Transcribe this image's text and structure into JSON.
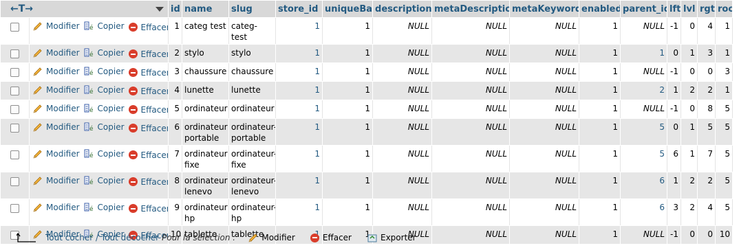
{
  "actions": {
    "edit": "Modifier",
    "copy": "Copier",
    "delete": "Effacer"
  },
  "header": {
    "nav_arrows": "←T→",
    "columns": [
      "id",
      "name",
      "slug",
      "store_id",
      "uniqueBase",
      "description",
      "metaDescription",
      "metaKeywords",
      "enabled",
      "parent_id",
      "lft",
      "lvl",
      "rgt",
      "root"
    ]
  },
  "rows": [
    {
      "id": "1",
      "name": "categ test",
      "slug": "categ-test",
      "store_id": "1",
      "uniqueBase": "1",
      "description": "NULL",
      "metaDescription": "NULL",
      "metaKeywords": "NULL",
      "enabled": "1",
      "parent_id": "NULL",
      "lft": "-1",
      "lvl": "0",
      "rgt": "4",
      "root": "1"
    },
    {
      "id": "2",
      "name": "stylo",
      "slug": "stylo",
      "store_id": "1",
      "uniqueBase": "1",
      "description": "NULL",
      "metaDescription": "NULL",
      "metaKeywords": "NULL",
      "enabled": "1",
      "parent_id": "1",
      "lft": "0",
      "lvl": "1",
      "rgt": "3",
      "root": "1"
    },
    {
      "id": "3",
      "name": "chaussure",
      "slug": "chaussure",
      "store_id": "1",
      "uniqueBase": "1",
      "description": "NULL",
      "metaDescription": "NULL",
      "metaKeywords": "NULL",
      "enabled": "1",
      "parent_id": "NULL",
      "lft": "-1",
      "lvl": "0",
      "rgt": "0",
      "root": "3"
    },
    {
      "id": "4",
      "name": "lunette",
      "slug": "lunette",
      "store_id": "1",
      "uniqueBase": "1",
      "description": "NULL",
      "metaDescription": "NULL",
      "metaKeywords": "NULL",
      "enabled": "1",
      "parent_id": "2",
      "lft": "1",
      "lvl": "2",
      "rgt": "2",
      "root": "1"
    },
    {
      "id": "5",
      "name": "ordinateur",
      "slug": "ordinateur",
      "store_id": "1",
      "uniqueBase": "1",
      "description": "NULL",
      "metaDescription": "NULL",
      "metaKeywords": "NULL",
      "enabled": "1",
      "parent_id": "NULL",
      "lft": "-1",
      "lvl": "0",
      "rgt": "8",
      "root": "5"
    },
    {
      "id": "6",
      "name": "ordinateur portable",
      "slug": "ordinateur-portable",
      "store_id": "1",
      "uniqueBase": "1",
      "description": "NULL",
      "metaDescription": "NULL",
      "metaKeywords": "NULL",
      "enabled": "1",
      "parent_id": "5",
      "lft": "0",
      "lvl": "1",
      "rgt": "5",
      "root": "5"
    },
    {
      "id": "7",
      "name": "ordinateur fixe",
      "slug": "ordinateur-fixe",
      "store_id": "1",
      "uniqueBase": "1",
      "description": "NULL",
      "metaDescription": "NULL",
      "metaKeywords": "NULL",
      "enabled": "1",
      "parent_id": "5",
      "lft": "6",
      "lvl": "1",
      "rgt": "7",
      "root": "5"
    },
    {
      "id": "8",
      "name": "ordinateur lenevo",
      "slug": "ordinateur-lenevo",
      "store_id": "1",
      "uniqueBase": "1",
      "description": "NULL",
      "metaDescription": "NULL",
      "metaKeywords": "NULL",
      "enabled": "1",
      "parent_id": "6",
      "lft": "1",
      "lvl": "2",
      "rgt": "2",
      "root": "5"
    },
    {
      "id": "9",
      "name": "ordinateur hp",
      "slug": "ordinateur-hp",
      "store_id": "1",
      "uniqueBase": "1",
      "description": "NULL",
      "metaDescription": "NULL",
      "metaKeywords": "NULL",
      "enabled": "1",
      "parent_id": "6",
      "lft": "3",
      "lvl": "2",
      "rgt": "4",
      "root": "5"
    },
    {
      "id": "10",
      "name": "tablette",
      "slug": "tablette",
      "store_id": "1",
      "uniqueBase": "1",
      "description": "NULL",
      "metaDescription": "NULL",
      "metaKeywords": "NULL",
      "enabled": "1",
      "parent_id": "NULL",
      "lft": "-1",
      "lvl": "0",
      "rgt": "0",
      "root": "10"
    }
  ],
  "footer": {
    "check_all": "Tout cocher",
    "separator": " / ",
    "uncheck_all": "Tout décocher",
    "with_selected": "Pour la sélection :",
    "edit": "Modifier",
    "delete": "Effacer",
    "export": "Exporter"
  },
  "colors": {
    "link": "#235a81",
    "header_bg": "#d8d8d8",
    "row_even": "#e6e6e6",
    "delete_icon": "#d93d2b"
  }
}
